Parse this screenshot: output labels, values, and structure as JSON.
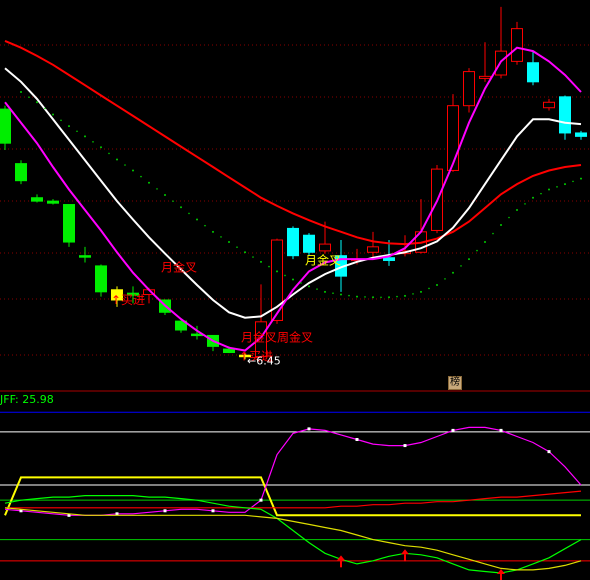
{
  "badge": "榜",
  "indicator_label": "JFF: 25.98",
  "low_label": "←6.45",
  "chart_data": [
    {
      "type": "candlestick",
      "title": "",
      "ylim": [
        6.0,
        11.5
      ],
      "candles": [
        {
          "o": 9.9,
          "h": 9.95,
          "l": 9.3,
          "c": 9.4,
          "color": "#00ee00"
        },
        {
          "o": 9.1,
          "h": 9.15,
          "l": 8.8,
          "c": 8.85,
          "color": "#00ee00"
        },
        {
          "o": 8.6,
          "h": 8.65,
          "l": 8.53,
          "c": 8.55,
          "color": "#00ee00"
        },
        {
          "o": 8.55,
          "h": 8.58,
          "l": 8.5,
          "c": 8.52,
          "color": "#00ee00"
        },
        {
          "o": 8.5,
          "h": 8.5,
          "l": 7.88,
          "c": 7.95,
          "color": "#00ee00"
        },
        {
          "o": 7.75,
          "h": 7.88,
          "l": 7.65,
          "c": 7.75,
          "color": "#00ee00"
        },
        {
          "o": 7.6,
          "h": 7.62,
          "l": 7.15,
          "c": 7.22,
          "color": "#00ee00"
        },
        {
          "o": 7.1,
          "h": 7.3,
          "l": 7.0,
          "c": 7.25,
          "color": "#ffff00"
        },
        {
          "o": 7.2,
          "h": 7.3,
          "l": 7.05,
          "c": 7.17,
          "color": "#00ee00"
        },
        {
          "o": 7.18,
          "h": 7.28,
          "l": 7.05,
          "c": 7.25,
          "color": "#ff0000"
        },
        {
          "o": 7.1,
          "h": 7.1,
          "l": 6.88,
          "c": 6.92,
          "color": "#00ee00"
        },
        {
          "o": 6.79,
          "h": 6.8,
          "l": 6.62,
          "c": 6.66,
          "color": "#00ee00"
        },
        {
          "o": 6.6,
          "h": 6.72,
          "l": 6.52,
          "c": 6.58,
          "color": "#00ee00"
        },
        {
          "o": 6.58,
          "h": 6.58,
          "l": 6.35,
          "c": 6.42,
          "color": "#00ee00"
        },
        {
          "o": 6.38,
          "h": 6.42,
          "l": 6.32,
          "c": 6.33,
          "color": "#00ee00"
        },
        {
          "o": 6.28,
          "h": 6.33,
          "l": 6.23,
          "c": 6.29,
          "color": "#ffff00"
        },
        {
          "o": 6.27,
          "h": 7.33,
          "l": 6.25,
          "c": 6.78,
          "color": "#ff0000"
        },
        {
          "o": 6.8,
          "h": 8.0,
          "l": 6.75,
          "c": 7.98,
          "color": "#ff0000"
        },
        {
          "o": 7.75,
          "h": 8.18,
          "l": 7.7,
          "c": 8.15,
          "color": "#00ffff"
        },
        {
          "o": 8.05,
          "h": 8.08,
          "l": 7.75,
          "c": 7.8,
          "color": "#00ffff"
        },
        {
          "o": 7.92,
          "h": 8.25,
          "l": 7.78,
          "c": 7.82,
          "color": "#ff0000"
        },
        {
          "o": 7.75,
          "h": 7.98,
          "l": 7.22,
          "c": 7.45,
          "color": "#00ffff"
        },
        {
          "o": 7.7,
          "h": 7.85,
          "l": 7.62,
          "c": 7.68,
          "color": "#ff0000"
        },
        {
          "o": 7.8,
          "h": 8.1,
          "l": 7.7,
          "c": 7.88,
          "color": "#ff0000"
        },
        {
          "o": 7.68,
          "h": 7.98,
          "l": 7.6,
          "c": 7.72,
          "color": "#00ffff"
        },
        {
          "o": 7.78,
          "h": 8.05,
          "l": 7.74,
          "c": 7.82,
          "color": "#ff0000"
        },
        {
          "o": 7.8,
          "h": 8.58,
          "l": 7.78,
          "c": 8.1,
          "color": "#ff0000"
        },
        {
          "o": 8.12,
          "h": 9.08,
          "l": 8.08,
          "c": 9.02,
          "color": "#ff0000"
        },
        {
          "o": 9.0,
          "h": 10.12,
          "l": 8.98,
          "c": 9.95,
          "color": "#ff0000"
        },
        {
          "o": 9.95,
          "h": 10.5,
          "l": 9.85,
          "c": 10.45,
          "color": "#ff0000"
        },
        {
          "o": 10.35,
          "h": 10.88,
          "l": 10.3,
          "c": 10.38,
          "color": "#ff0000"
        },
        {
          "o": 10.4,
          "h": 11.4,
          "l": 10.35,
          "c": 10.75,
          "color": "#ff0000"
        },
        {
          "o": 10.6,
          "h": 11.18,
          "l": 10.55,
          "c": 11.08,
          "color": "#ff0000"
        },
        {
          "o": 10.58,
          "h": 10.75,
          "l": 10.25,
          "c": 10.3,
          "color": "#00ffff"
        },
        {
          "o": 10.0,
          "h": 10.05,
          "l": 9.88,
          "c": 9.92,
          "color": "#ff0000"
        },
        {
          "o": 10.08,
          "h": 10.1,
          "l": 9.45,
          "c": 9.55,
          "color": "#00ffff"
        },
        {
          "o": 9.55,
          "h": 9.58,
          "l": 9.45,
          "c": 9.5,
          "color": "#00ffff"
        }
      ],
      "lines": [
        {
          "color": "#ff0000",
          "values": [
            10.9,
            10.8,
            10.68,
            10.55,
            10.4,
            10.25,
            10.1,
            9.95,
            9.8,
            9.65,
            9.5,
            9.35,
            9.2,
            9.05,
            8.9,
            8.75,
            8.6,
            8.48,
            8.37,
            8.27,
            8.18,
            8.1,
            8.02,
            7.96,
            7.93,
            7.92,
            7.94,
            8.0,
            8.1,
            8.25,
            8.45,
            8.65,
            8.8,
            8.92,
            9.0,
            9.05,
            9.08
          ]
        },
        {
          "color": "#ffffff",
          "values": [
            10.5,
            10.3,
            10.05,
            9.75,
            9.45,
            9.15,
            8.85,
            8.55,
            8.28,
            8.02,
            7.78,
            7.55,
            7.32,
            7.1,
            6.92,
            6.84,
            6.86,
            7.0,
            7.18,
            7.35,
            7.48,
            7.58,
            7.66,
            7.72,
            7.76,
            7.8,
            7.86,
            7.96,
            8.16,
            8.45,
            8.8,
            9.15,
            9.5,
            9.75,
            9.75,
            9.7,
            9.68
          ]
        },
        {
          "color": "#ff00ff",
          "values": [
            10.0,
            9.7,
            9.4,
            9.05,
            8.72,
            8.42,
            8.12,
            7.8,
            7.5,
            7.25,
            7.02,
            6.82,
            6.65,
            6.5,
            6.4,
            6.36,
            6.55,
            6.9,
            7.25,
            7.52,
            7.65,
            7.7,
            7.7,
            7.7,
            7.74,
            7.86,
            8.1,
            8.55,
            9.1,
            9.7,
            10.2,
            10.6,
            10.8,
            10.75,
            10.6,
            10.4,
            10.15
          ]
        },
        {
          "color": "#00cc00",
          "dotted": true,
          "values": [
            null,
            10.15,
            10.0,
            9.82,
            9.65,
            9.5,
            9.34,
            9.16,
            9.0,
            8.82,
            8.64,
            8.46,
            8.28,
            8.1,
            7.95,
            7.8,
            7.66,
            7.52,
            7.4,
            7.3,
            7.22,
            7.18,
            7.15,
            7.14,
            7.14,
            7.16,
            7.22,
            7.32,
            7.5,
            7.7,
            7.95,
            8.2,
            8.42,
            8.6,
            8.72,
            8.8,
            8.88
          ]
        }
      ],
      "annotations": [
        {
          "text": "月金叉",
          "idx": 10,
          "y": 7.58,
          "color": "#ff0000"
        },
        {
          "text": "买进",
          "idx": 7,
          "y": 7.1,
          "color": "#ff0000",
          "arrow": true
        },
        {
          "text": "月金叉周金叉",
          "idx": 15,
          "y": 6.55,
          "color": "#ff0000"
        },
        {
          "text": "买进",
          "idx": 15,
          "y": 6.27,
          "color": "#ff0000",
          "arrow": true
        },
        {
          "text": "月金叉",
          "idx": 19,
          "y": 7.68,
          "color": "#ffff00"
        }
      ],
      "low_point": {
        "idx": 15,
        "value": 6.45
      }
    },
    {
      "type": "line",
      "title": "JFF: 25.98",
      "ylim": [
        -10,
        110
      ],
      "ref_lines": [
        {
          "value": 98,
          "color": "#0000ff"
        },
        {
          "value": 85,
          "color": "#ffffff"
        },
        {
          "value": 50,
          "color": "#ffffff"
        },
        {
          "value": 40,
          "color": "#00cc00"
        },
        {
          "value": 14,
          "color": "#00cc00"
        },
        {
          "value": 0,
          "color": "#ff0000"
        }
      ],
      "series": [
        {
          "color": "#ffff00",
          "values": [
            30,
            55,
            55,
            55,
            55,
            55,
            55,
            55,
            55,
            55,
            55,
            55,
            55,
            55,
            55,
            55,
            55,
            30,
            30,
            30,
            30,
            30,
            30,
            30,
            30,
            30,
            30,
            30,
            30,
            30,
            30,
            30,
            30,
            30,
            30,
            30,
            30
          ]
        },
        {
          "color": "#ff00ff",
          "values": [
            34,
            33,
            32,
            31,
            30,
            30,
            30,
            31,
            31,
            32,
            33,
            34,
            34,
            33,
            32,
            32,
            40,
            70,
            84,
            87,
            86,
            83,
            80,
            77,
            76,
            76,
            78,
            82,
            86,
            88,
            88,
            86,
            82,
            78,
            72,
            62,
            50
          ]
        },
        {
          "color": "#ff0000",
          "values": [
            35,
            35,
            35,
            35,
            35,
            35,
            35,
            35,
            35,
            35,
            35,
            35,
            35,
            35,
            35,
            35,
            35,
            35,
            35,
            35,
            35,
            36,
            36,
            37,
            37,
            38,
            38,
            39,
            39,
            40,
            41,
            42,
            42,
            43,
            44,
            45,
            46
          ]
        },
        {
          "color": "#00ff00",
          "values": [
            38,
            40,
            41,
            42,
            42,
            43,
            43,
            43,
            43,
            42,
            42,
            41,
            40,
            38,
            36,
            35,
            34,
            28,
            20,
            12,
            5,
            1,
            -2,
            0,
            3,
            5,
            4,
            2,
            -2,
            -6,
            -7,
            -8,
            -6,
            -2,
            2,
            8,
            14
          ]
        },
        {
          "color": "#dddd00",
          "values": [
            35,
            34,
            33,
            32,
            31,
            30,
            30,
            30,
            30,
            30,
            30,
            30,
            30,
            30,
            30,
            30,
            29,
            28,
            26,
            24,
            22,
            20,
            17,
            14,
            12,
            10,
            9,
            7,
            4,
            1,
            -2,
            -5,
            -6,
            -6,
            -5,
            -3,
            0
          ]
        }
      ],
      "arrows": [
        {
          "idx": 21
        },
        {
          "idx": 25
        },
        {
          "idx": 31
        }
      ]
    }
  ]
}
